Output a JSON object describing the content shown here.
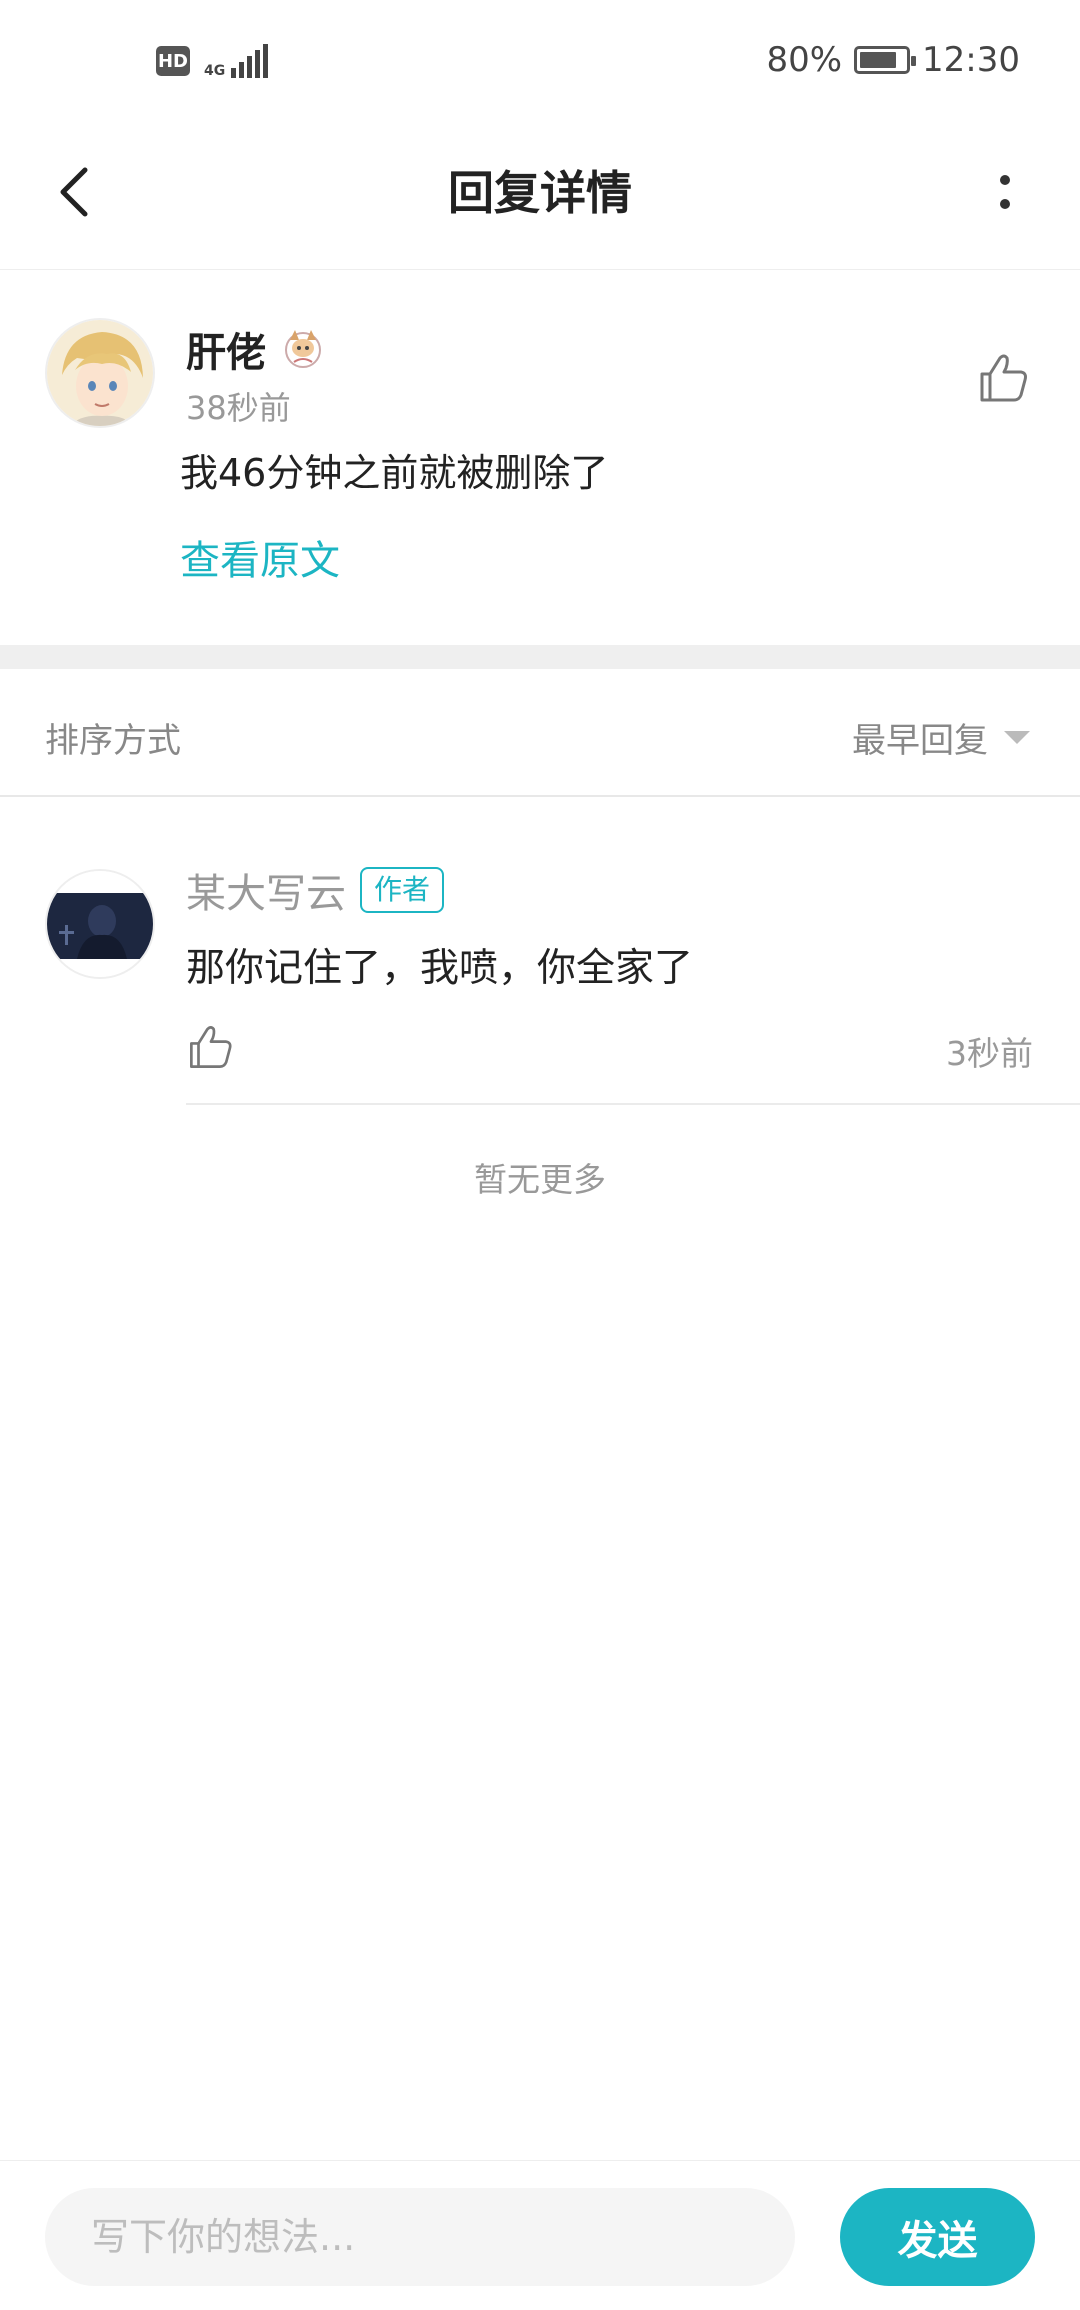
{
  "status_bar": {
    "hd": "HD",
    "network": "4G",
    "battery": "80%",
    "time": "12:30"
  },
  "header": {
    "title": "回复详情"
  },
  "original": {
    "user_name": "肝佬",
    "time": "38秒前",
    "text": "我46分钟之前就被删除了",
    "view_original": "查看原文"
  },
  "sort": {
    "label": "排序方式",
    "selected": "最早回复"
  },
  "replies": [
    {
      "user_name": "某大写云",
      "tag": "作者",
      "text": "那你记住了，我喷，你全家了",
      "time": "3秒前"
    }
  ],
  "no_more": "暂无更多",
  "composer": {
    "placeholder": "写下你的想法...",
    "send": "发送"
  },
  "colors": {
    "accent": "#1cb5c3",
    "muted": "#999999"
  }
}
